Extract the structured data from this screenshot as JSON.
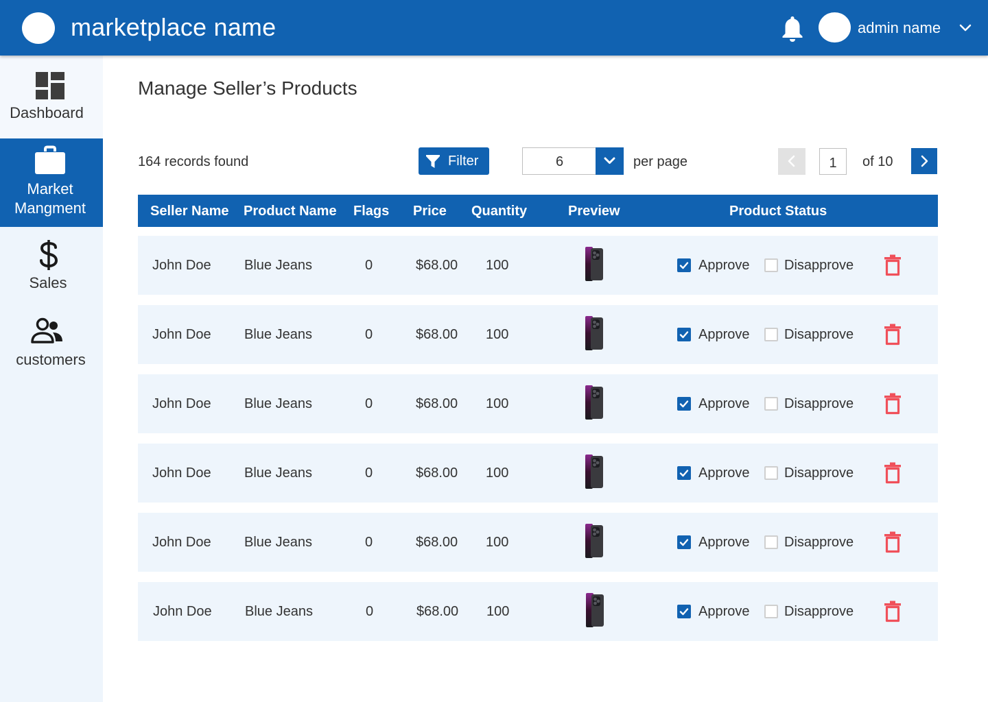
{
  "header": {
    "brand": "marketplace name",
    "admin_name": "admin name",
    "colors": {
      "primary": "#1162B1"
    },
    "icons": {
      "notifications": "bell-icon",
      "account_menu": "chevron-down-icon"
    }
  },
  "sidebar": {
    "items": [
      {
        "label": "Dashboard",
        "icon": "dashboard-icon",
        "active": false
      },
      {
        "label": "Market\nMangment",
        "icon": "briefcase-icon",
        "active": true
      },
      {
        "label": "Sales",
        "icon": "dollar-icon",
        "active": false
      },
      {
        "label": "customers",
        "icon": "people-icon",
        "active": false
      }
    ]
  },
  "main": {
    "title": "Manage Seller’s Products",
    "records_found": "164 records found",
    "filter_label": "Filter",
    "per_page_value": "6",
    "per_page_label": "per page",
    "pagination": {
      "current_page": "1",
      "of_label": "of 10"
    }
  },
  "table": {
    "columns": [
      "Seller Name",
      "Product Name",
      "Flags",
      "Price",
      "Quantity",
      "Preview",
      "Product Status"
    ],
    "status_labels": {
      "approve": "Approve",
      "disapprove": "Disapprove"
    },
    "delete_color": "#F0505A",
    "rows": [
      {
        "seller": "John Doe",
        "product": "Blue Jeans",
        "flags": "0",
        "price": "$68.00",
        "quantity": "100",
        "preview": "phone-image",
        "approved": true,
        "disapproved": false
      },
      {
        "seller": "John Doe",
        "product": "Blue Jeans",
        "flags": "0",
        "price": "$68.00",
        "quantity": "100",
        "preview": "phone-image",
        "approved": true,
        "disapproved": false
      },
      {
        "seller": "John Doe",
        "product": "Blue Jeans",
        "flags": "0",
        "price": "$68.00",
        "quantity": "100",
        "preview": "phone-image",
        "approved": true,
        "disapproved": false
      },
      {
        "seller": "John Doe",
        "product": "Blue Jeans",
        "flags": "0",
        "price": "$68.00",
        "quantity": "100",
        "preview": "phone-image",
        "approved": true,
        "disapproved": false
      },
      {
        "seller": "John Doe",
        "product": "Blue Jeans",
        "flags": "0",
        "price": "$68.00",
        "quantity": "100",
        "preview": "phone-image",
        "approved": true,
        "disapproved": false
      },
      {
        "seller": "John Doe",
        "product": "Blue Jeans",
        "flags": "0",
        "price": "$68.00",
        "quantity": "100",
        "preview": "phone-image",
        "approved": true,
        "disapproved": false
      }
    ]
  }
}
